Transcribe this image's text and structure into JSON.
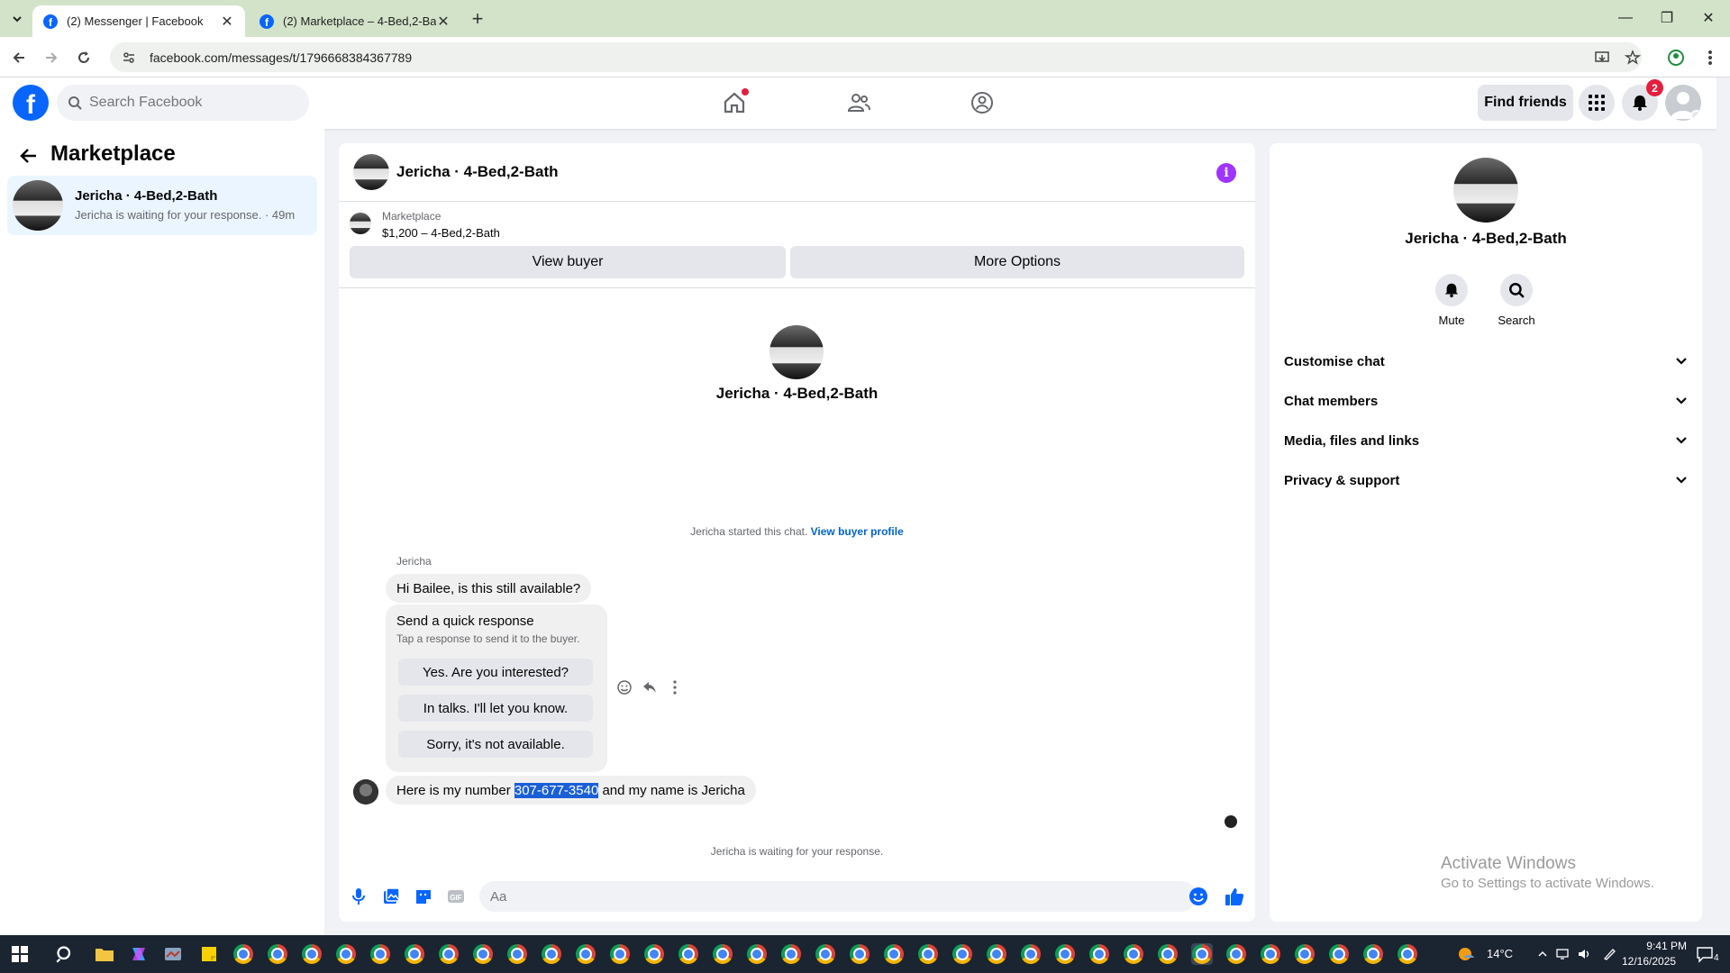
{
  "browser": {
    "tabs": [
      {
        "label": "(2) Messenger | Facebook",
        "active": true
      },
      {
        "label": "(2) Marketplace – 4-Bed,2-Bath",
        "active": false
      }
    ],
    "url": "facebook.com/messages/t/1796668384367789"
  },
  "fb": {
    "search_placeholder": "Search Facebook",
    "find_friends": "Find friends",
    "notifications_count": "2"
  },
  "left": {
    "title": "Marketplace",
    "conversation": {
      "name": "Jericha · 4-Bed,2-Bath",
      "preview": "Jericha is waiting for your response. · 49m"
    }
  },
  "chat": {
    "header_name": "Jericha · 4-Bed,2-Bath",
    "listing_category": "Marketplace",
    "listing_price": "$1,200 – 4-Bed,2-Bath",
    "view_buyer": "View buyer",
    "more_options": "More Options",
    "center_name": "Jericha · 4-Bed,2-Bath",
    "started_text": "Jericha started this chat.",
    "started_link": "View buyer profile",
    "sender": "Jericha",
    "message1": "Hi Bailee, is this still available?",
    "quick_title": "Send a quick response",
    "quick_sub": "Tap a response to send it to the buyer.",
    "quick_replies": [
      "Yes. Are you interested?",
      "In talks. I'll let you know.",
      "Sorry, it's not available."
    ],
    "message2_pre": "Here is my number ",
    "message2_highlight": "307-677-3540",
    "message2_post": " and my name is Jericha",
    "waiting": "Jericha is waiting for your response.",
    "composer_placeholder": "Aa"
  },
  "right": {
    "name": "Jericha · 4-Bed,2-Bath",
    "actions": [
      "Mute",
      "Search"
    ],
    "rows": [
      "Customise chat",
      "Chat members",
      "Media, files and links",
      "Privacy & support"
    ]
  },
  "watermark": {
    "line1": "Activate Windows",
    "line2": "Go to Settings to activate Windows."
  },
  "taskbar": {
    "temperature": "14°C",
    "time": "9:41 PM",
    "date": "12/16/2025",
    "notif_count": "4"
  },
  "colors": {
    "brand": "#0866ff",
    "info_purple": "#a033ff",
    "highlight": "#1a5fd6",
    "badge_red": "#e41e3f"
  }
}
